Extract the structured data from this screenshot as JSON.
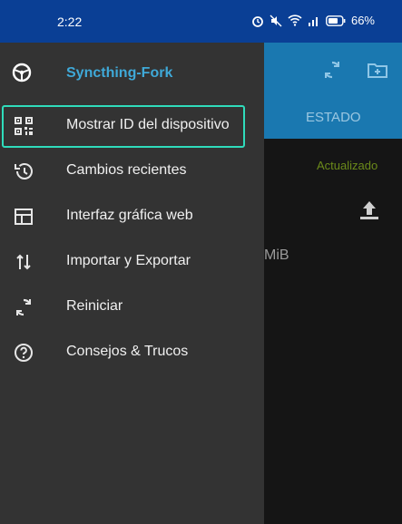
{
  "status_bar": {
    "time": "2:22",
    "battery": "66%",
    "icons": [
      "alarm-icon",
      "mute-icon",
      "wifi-icon",
      "signal-icon",
      "battery-icon"
    ]
  },
  "drawer": {
    "title": "Syncthing-Fork",
    "items": [
      {
        "label": "Mostrar ID del dispositivo",
        "icon": "qr-code-icon",
        "highlighted": true
      },
      {
        "label": "Cambios recientes",
        "icon": "history-icon"
      },
      {
        "label": "Interfaz gráfica web",
        "icon": "web-gui-icon"
      },
      {
        "label": "Importar y Exportar",
        "icon": "import-export-icon"
      },
      {
        "label": "Reiniciar",
        "icon": "restart-icon"
      },
      {
        "label": "Consejos & Trucos",
        "icon": "help-icon"
      }
    ]
  },
  "background_app": {
    "tab_label": "ESTADO",
    "status_text": "Actualizado",
    "size_text": "MiB"
  },
  "colors": {
    "status_bar": "#0a3f95",
    "toolbar": "#1a78b0",
    "drawer": "#333333",
    "title": "#3fa9d8",
    "highlight": "#2fdcbb"
  }
}
